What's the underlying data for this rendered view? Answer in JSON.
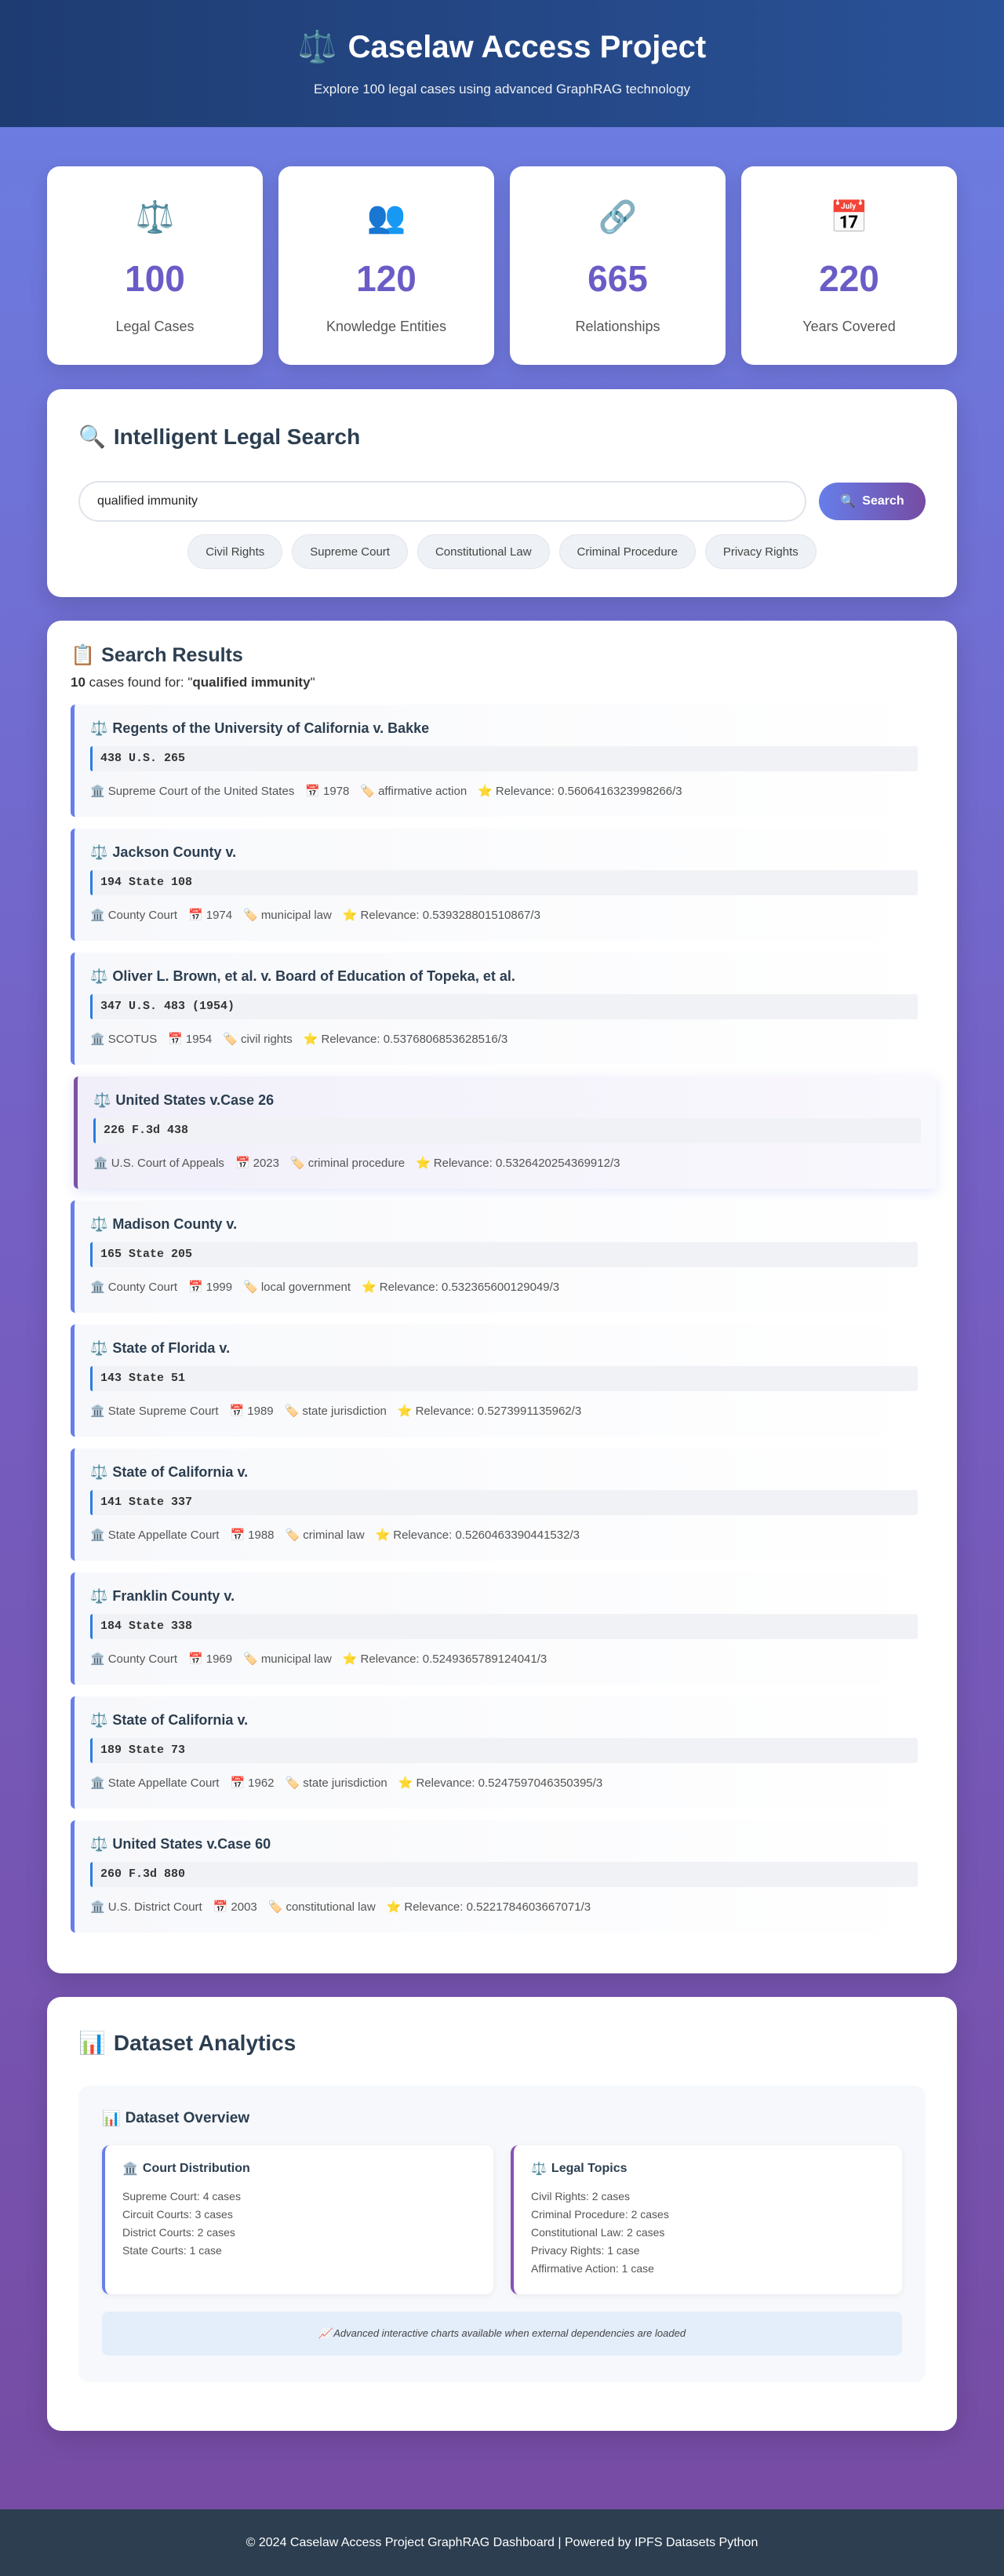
{
  "header": {
    "icon": "⚖️",
    "title": "Caselaw Access Project",
    "subtitle": "Explore 100 legal cases using advanced GraphRAG technology"
  },
  "stats": [
    {
      "icon": "⚖️",
      "value": "100",
      "label": "Legal Cases"
    },
    {
      "icon": "👥",
      "value": "120",
      "label": "Knowledge Entities"
    },
    {
      "icon": "🔗",
      "value": "665",
      "label": "Relationships"
    },
    {
      "icon": "📅",
      "value": "220",
      "label": "Years Covered"
    }
  ],
  "search": {
    "icon": "🔍",
    "title": "Intelligent Legal Search",
    "value": "qualified immunity",
    "button_icon": "🔍",
    "button_label": "Search",
    "chips": [
      "Civil Rights",
      "Supreme Court",
      "Constitutional Law",
      "Criminal Procedure",
      "Privacy Rights"
    ]
  },
  "results": {
    "icon": "📋",
    "title": "Search Results",
    "count": "10",
    "summary_mid": " cases found for: \"",
    "query": "qualified immunity",
    "summary_end": "\"",
    "items": [
      {
        "title": "Regents of the University of California v. Bakke",
        "citation": "438 U.S. 265",
        "court": "Supreme Court of the United States",
        "year": "1978",
        "topic": "affirmative action",
        "relevance": "Relevance: 0.5606416323998266/3"
      },
      {
        "title": "Jackson County v.",
        "citation": "194 State 108",
        "court": "County Court",
        "year": "1974",
        "topic": "municipal law",
        "relevance": "Relevance: 0.539328801510867/3"
      },
      {
        "title": "Oliver L. Brown, et al. v. Board of Education of Topeka, et al.",
        "citation": "347 U.S. 483 (1954)",
        "court": "SCOTUS",
        "year": "1954",
        "topic": "civil rights",
        "relevance": "Relevance: 0.5376806853628516/3"
      },
      {
        "title": "United States v.Case 26",
        "citation": "226 F.3d 438",
        "court": "U.S. Court of Appeals",
        "year": "2023",
        "topic": "criminal procedure",
        "relevance": "Relevance: 0.5326420254369912/3"
      },
      {
        "title": "Madison County v.",
        "citation": "165 State 205",
        "court": "County Court",
        "year": "1999",
        "topic": "local government",
        "relevance": "Relevance: 0.532365600129049/3"
      },
      {
        "title": "State of Florida v.",
        "citation": "143 State 51",
        "court": "State Supreme Court",
        "year": "1989",
        "topic": "state jurisdiction",
        "relevance": "Relevance: 0.5273991135962/3"
      },
      {
        "title": "State of California v.",
        "citation": "141 State 337",
        "court": "State Appellate Court",
        "year": "1988",
        "topic": "criminal law",
        "relevance": "Relevance: 0.5260463390441532/3"
      },
      {
        "title": "Franklin County v.",
        "citation": "184 State 338",
        "court": "County Court",
        "year": "1969",
        "topic": "municipal law",
        "relevance": "Relevance: 0.5249365789124041/3"
      },
      {
        "title": "State of California v.",
        "citation": "189 State 73",
        "court": "State Appellate Court",
        "year": "1962",
        "topic": "state jurisdiction",
        "relevance": "Relevance: 0.5247597046350395/3"
      },
      {
        "title": "United States v.Case 60",
        "citation": "260 F.3d 880",
        "court": "U.S. District Court",
        "year": "2003",
        "topic": "constitutional law",
        "relevance": "Relevance: 0.5221784603667071/3"
      }
    ]
  },
  "analytics": {
    "icon": "📊",
    "title": "Dataset Analytics",
    "overview_icon": "📊",
    "overview_title": "Dataset Overview",
    "courts_icon": "🏛️",
    "courts_title": "Court Distribution",
    "courts": [
      "Supreme Court: 4 cases",
      "Circuit Courts: 3 cases",
      "District Courts: 2 cases",
      "State Courts: 1 case"
    ],
    "topics_icon": "⚖️",
    "topics_title": "Legal Topics",
    "topics": [
      "Civil Rights: 2 cases",
      "Criminal Procedure: 2 cases",
      "Constitutional Law: 2 cases",
      "Privacy Rights: 1 case",
      "Affirmative Action: 1 case"
    ],
    "notice": "📈 Advanced interactive charts available when external dependencies are loaded"
  },
  "footer": {
    "text": "© 2024 Caselaw Access Project GraphRAG Dashboard | Powered by IPFS Datasets Python"
  }
}
